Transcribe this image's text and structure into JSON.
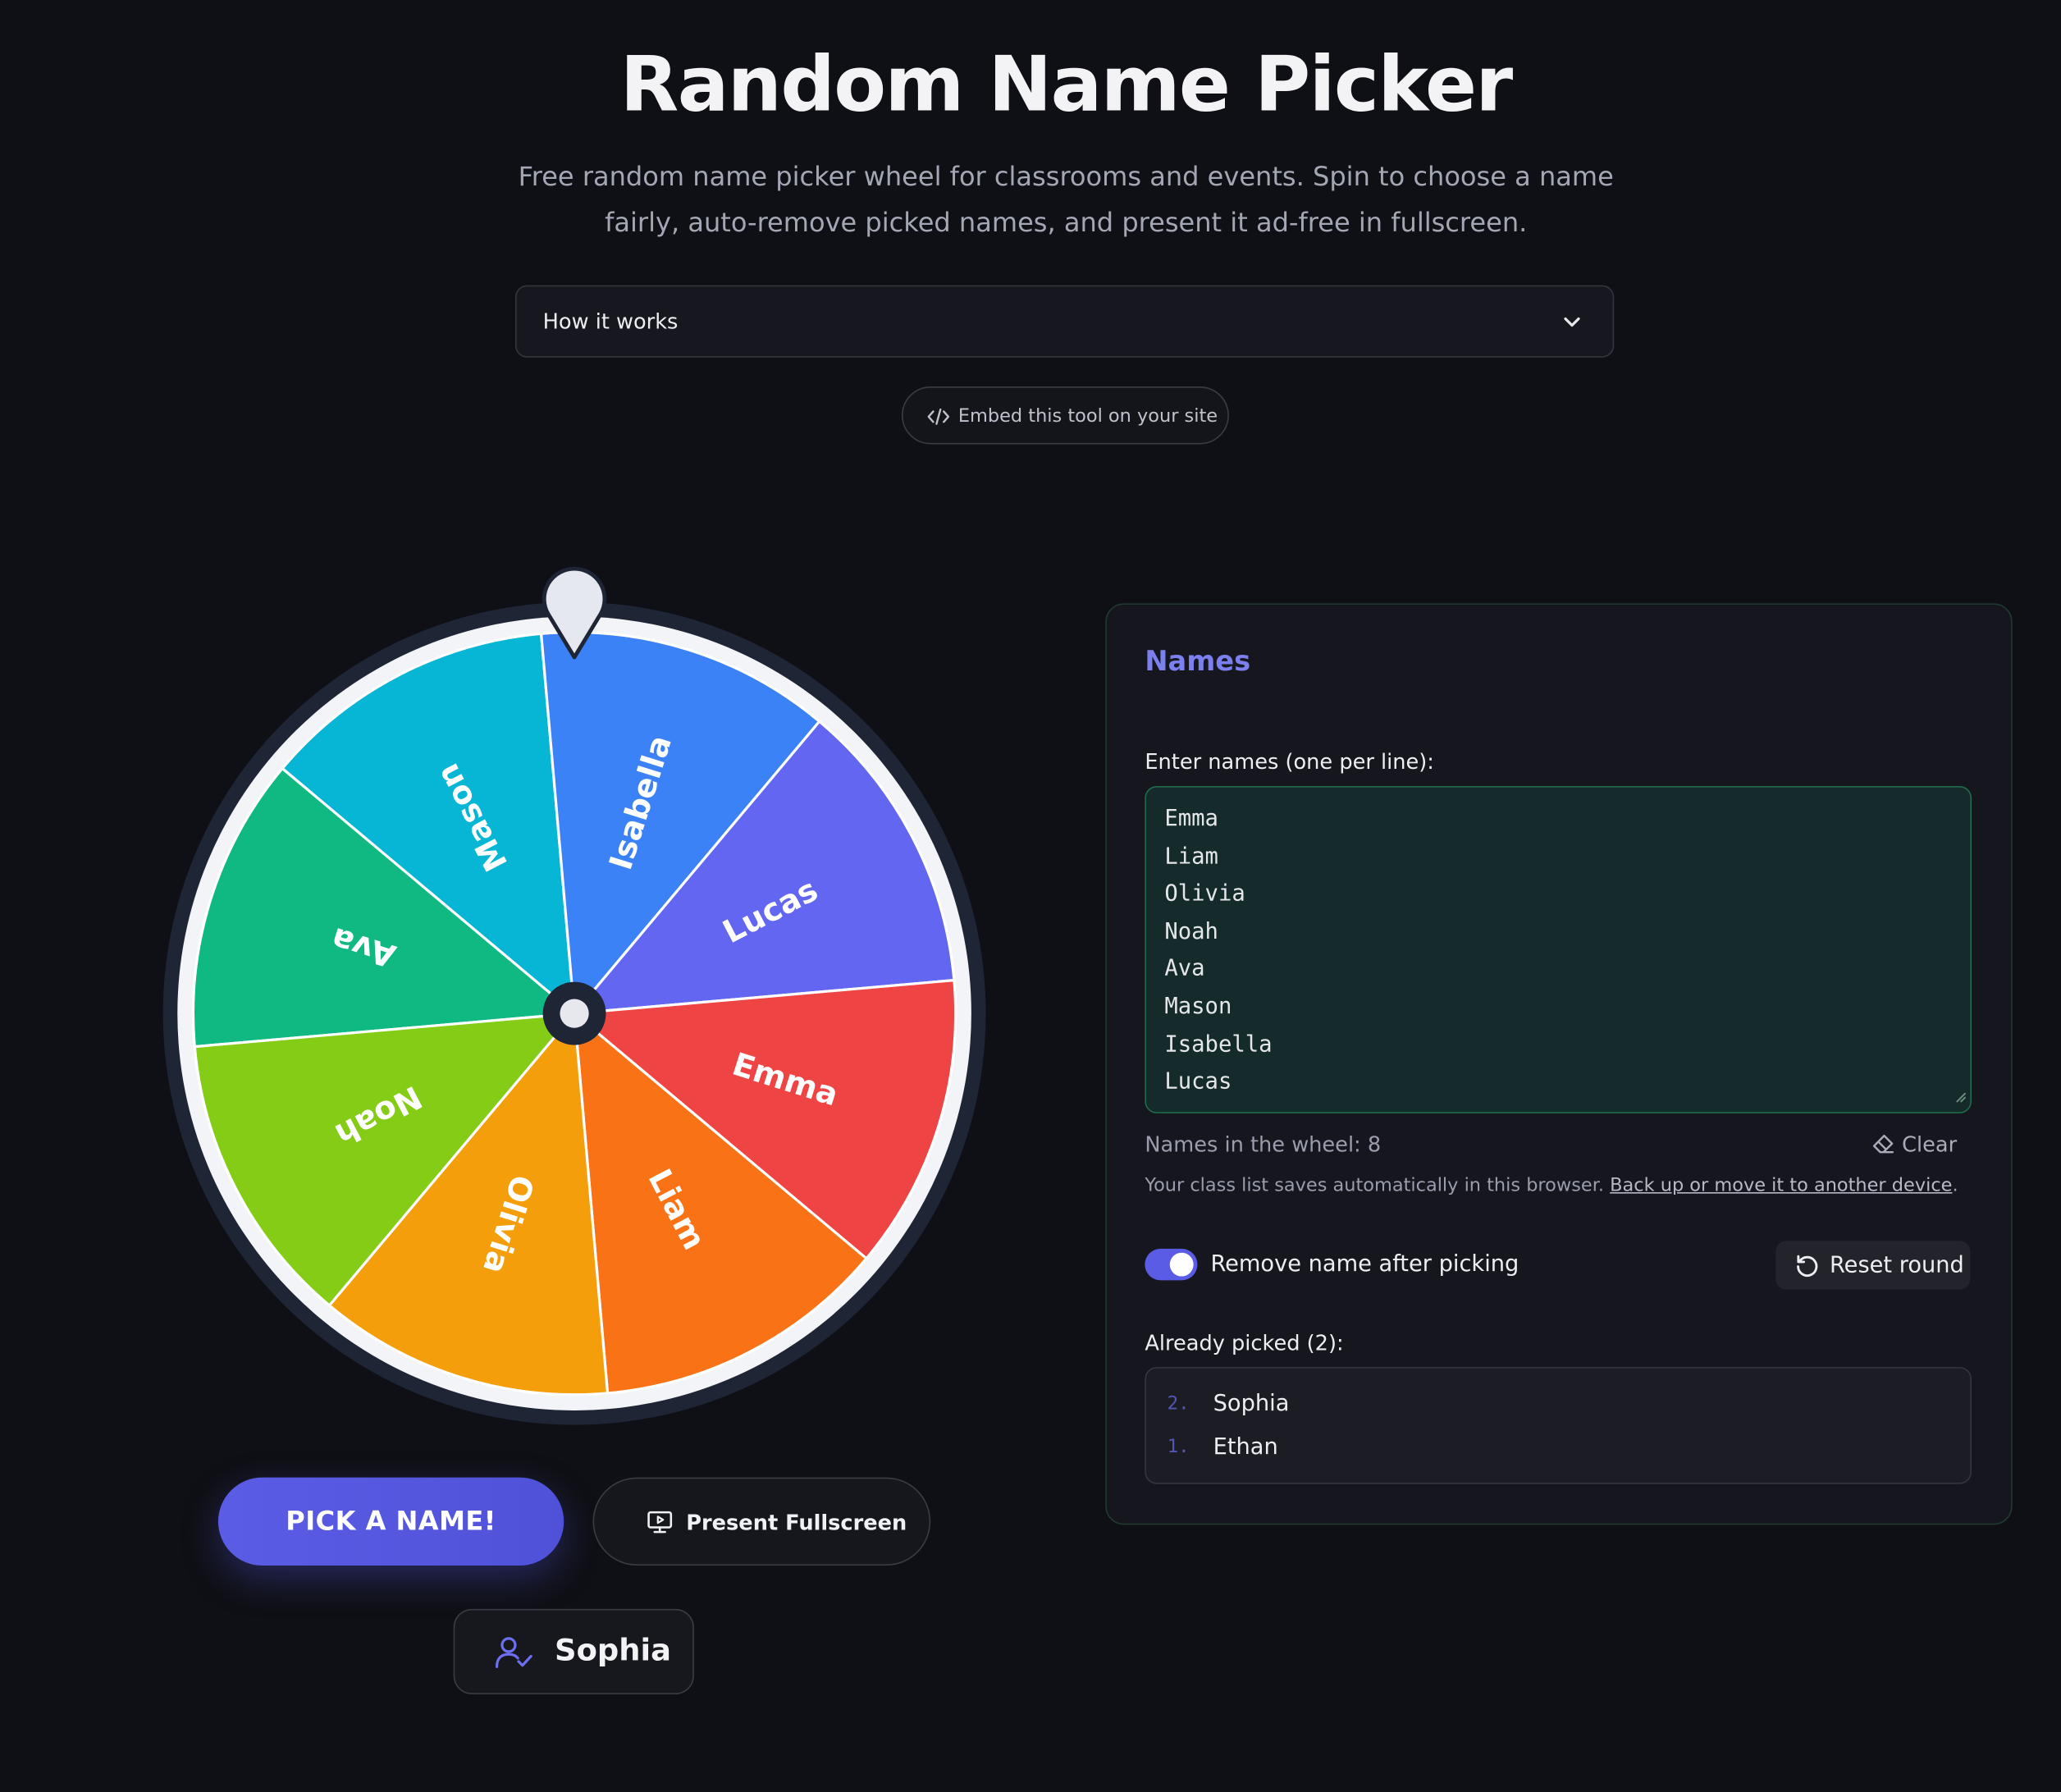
{
  "header": {
    "title": "Random Name Picker",
    "subtitle_line1": "Free random name picker wheel for classrooms and events. Spin to choose a name",
    "subtitle_line2": "fairly, auto-remove picked names, and present it ad-free in fullscreen."
  },
  "accordion": {
    "label": "How it works",
    "icon": "chevron-down-icon"
  },
  "embed": {
    "label": "Embed this tool on your site",
    "icon": "code-icon"
  },
  "wheel": {
    "segments": [
      {
        "name": "Ava",
        "color": "#10b981"
      },
      {
        "name": "Mason",
        "color": "#06b6d4"
      },
      {
        "name": "Isabella",
        "color": "#3b82f6"
      },
      {
        "name": "Lucas",
        "color": "#6366f1"
      },
      {
        "name": "Emma",
        "color": "#ef4444"
      },
      {
        "name": "Liam",
        "color": "#f97316"
      },
      {
        "name": "Olivia",
        "color": "#f59e0b"
      },
      {
        "name": "Noah",
        "color": "#84cc16"
      }
    ],
    "pointer_icon": "map-pin-pointer-icon"
  },
  "actions": {
    "pick_label": "PICK A NAME!",
    "present_label": "Present Fullscreen",
    "present_icon": "monitor-play-icon"
  },
  "result": {
    "name": "Sophia",
    "icon": "user-check-icon"
  },
  "panel": {
    "title": "Names",
    "field_label": "Enter names (one per line):",
    "names": [
      "Emma",
      "Liam",
      "Olivia",
      "Noah",
      "Ava",
      "Mason",
      "Isabella",
      "Lucas"
    ],
    "count_text": "Names in the wheel: 8",
    "clear_label": "Clear",
    "save_note": "Your class list saves automatically in this browser. ",
    "save_link": "Back up or move it to another device",
    "save_end": ".",
    "toggle_label": "Remove name after picking",
    "toggle_on": true,
    "reset_label": "Reset round",
    "picked_label": "Already picked (2):",
    "picked": [
      {
        "num": "2.",
        "name": "Sophia"
      },
      {
        "num": "1.",
        "name": "Ethan"
      }
    ]
  },
  "colors": {
    "accent": "#5b5ce6",
    "background": "#0f1015",
    "panel_title": "#7c80ee"
  }
}
